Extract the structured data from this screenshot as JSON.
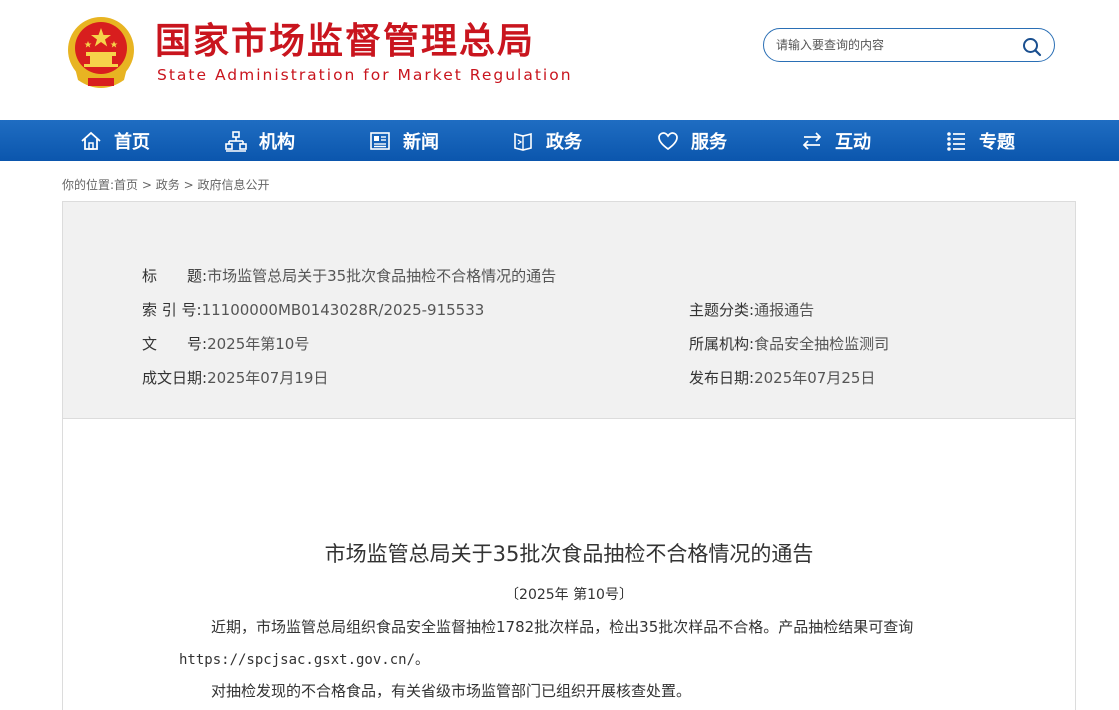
{
  "header": {
    "site_title": "国家市场监督管理总局",
    "site_subtitle": "State Administration for Market Regulation",
    "emblem_icon": "national-emblem-icon",
    "search": {
      "placeholder": "请输入要查询的内容",
      "value": ""
    },
    "colors": {
      "brand_red": "#c9151e",
      "nav_blue": "#0b56ad"
    }
  },
  "nav": {
    "items": [
      {
        "label": "首页",
        "icon": "home-icon"
      },
      {
        "label": "机构",
        "icon": "org-chart-icon"
      },
      {
        "label": "新闻",
        "icon": "newspaper-icon"
      },
      {
        "label": "政务",
        "icon": "book-icon"
      },
      {
        "label": "服务",
        "icon": "heart-icon"
      },
      {
        "label": "互动",
        "icon": "swap-arrows-icon"
      },
      {
        "label": "专题",
        "icon": "list-icon"
      }
    ]
  },
  "breadcrumb": {
    "prefix": "你的位置:",
    "items": [
      "首页",
      "政务",
      "政府信息公开"
    ],
    "separator": " > "
  },
  "meta": {
    "title_label": "标　　题:",
    "title_value": "市场监管总局关于35批次食品抽检不合格情况的通告",
    "index_label": "索 引 号:",
    "index_value": "11100000MB0143028R/2025-915533",
    "docno_label": "文　　号:",
    "docno_value": "2025年第10号",
    "date_label": "成文日期:",
    "date_value": "2025年07月19日",
    "category_label": "主题分类:",
    "category_value": "通报通告",
    "org_label": "所属机构:",
    "org_value": "食品安全抽检监测司",
    "publish_label": "发布日期:",
    "publish_value": "2025年07月25日"
  },
  "document": {
    "title": "市场监管总局关于35批次食品抽检不合格情况的通告",
    "number": "〔2025年 第10号〕",
    "para1": "近期，市场监管总局组织食品安全监督抽检1782批次样品，检出35批次样品不合格。产品抽检结果可查询",
    "para1_url": "https://spcjsac.gsxt.gov.cn/。",
    "para2": "对抽检发现的不合格食品，有关省级市场监管部门已组织开展核查处置。"
  }
}
